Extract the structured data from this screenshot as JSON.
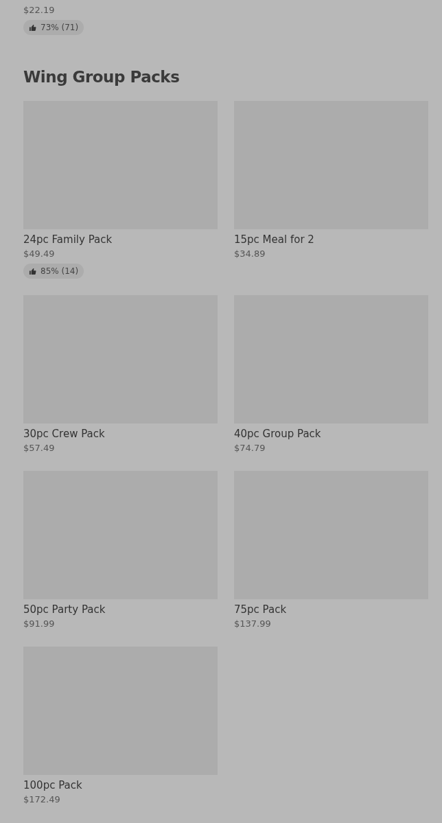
{
  "previous_item": {
    "price": "$22.19",
    "rating": "73% (71)"
  },
  "section": {
    "title": "Wing Group Packs",
    "items": [
      {
        "name": "24pc Family Pack",
        "price": "$49.49",
        "rating": "85% (14)"
      },
      {
        "name": "15pc Meal for 2",
        "price": "$34.89"
      },
      {
        "name": "30pc Crew Pack",
        "price": "$57.49"
      },
      {
        "name": "40pc Group Pack",
        "price": "$74.79"
      },
      {
        "name": "50pc Party Pack",
        "price": "$91.99"
      },
      {
        "name": "75pc Pack",
        "price": "$137.99"
      },
      {
        "name": "100pc Pack",
        "price": "$172.49"
      }
    ]
  }
}
